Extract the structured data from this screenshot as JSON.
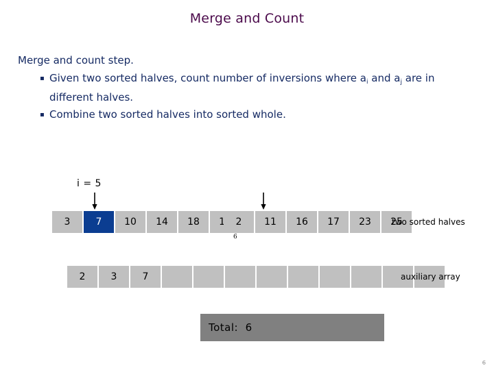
{
  "slide": {
    "title": "Merge and Count",
    "page_number": "6",
    "title_color": "#4b0a4b",
    "body_color": "#152a63"
  },
  "body": {
    "lead": "Merge and count step.",
    "bullet_marker": "▪",
    "bullets": [
      {
        "text_before": "Given two sorted halves, count number of inversions where a",
        "sub1": "i",
        "text_mid": " and a",
        "sub2": "j",
        "text_after": " are in different halves."
      },
      {
        "text_before": "Combine two sorted halves into sorted whole.",
        "sub1": "",
        "text_mid": "",
        "sub2": "",
        "text_after": ""
      }
    ]
  },
  "diagram": {
    "index_label": "i = 5",
    "left_half": [
      "3",
      "7",
      "10",
      "14",
      "18",
      "19"
    ],
    "left_highlight_index": 1,
    "right_half": [
      "2",
      "11",
      "16",
      "17",
      "23",
      "25"
    ],
    "right_highlight_index": -1,
    "inversion_count_label": "6",
    "aux_array": [
      "2",
      "3",
      "7",
      "",
      "",
      "",
      "",
      "",
      "",
      "",
      "",
      ""
    ],
    "caption_halves": "two sorted halves",
    "caption_aux": "auxiliary array",
    "cell_color": "#c0c0c0",
    "highlight_color": "#0b3d91",
    "total_bar_color": "#808080"
  },
  "total": {
    "label": "Total:",
    "value": "6"
  }
}
